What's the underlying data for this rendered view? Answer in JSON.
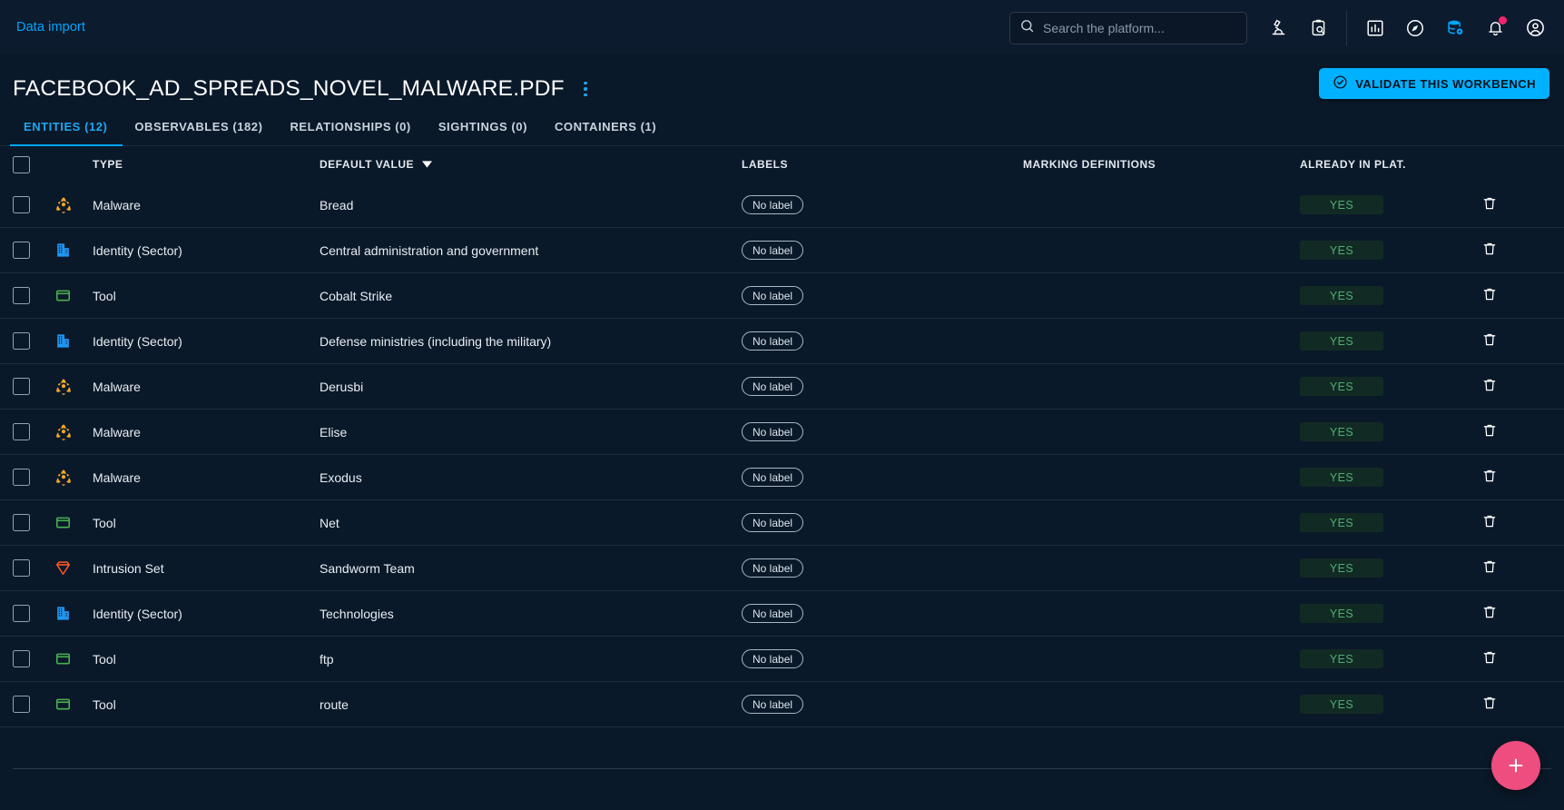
{
  "topbar": {
    "brand_link": "Data import",
    "search": {
      "placeholder": "Search the platform...",
      "value": ""
    },
    "icons": [
      "microscope-icon",
      "clipboard-search-icon",
      "chart-square-icon",
      "compass-icon",
      "database-settings-icon",
      "notification-bell-icon",
      "account-circle-icon"
    ]
  },
  "header": {
    "title": "FACEBOOK_AD_SPREADS_NOVEL_MALWARE.PDF",
    "more_menu": "more-options",
    "validate_label": "VALIDATE THIS WORKBENCH"
  },
  "tabs": [
    {
      "label": "ENTITIES (12)",
      "active": true
    },
    {
      "label": "OBSERVABLES (182)",
      "active": false
    },
    {
      "label": "RELATIONSHIPS (0)",
      "active": false
    },
    {
      "label": "SIGHTINGS (0)",
      "active": false
    },
    {
      "label": "CONTAINERS (1)",
      "active": false
    }
  ],
  "table": {
    "columns": {
      "type": "TYPE",
      "default_value": "DEFAULT VALUE",
      "labels": "LABELS",
      "marking_definitions": "MARKING DEFINITIONS",
      "already_in_plat": "ALREADY IN PLAT."
    },
    "sort": {
      "column": "DEFAULT VALUE",
      "direction": "desc"
    },
    "rows": [
      {
        "type": "Malware",
        "icon": "biohazard-icon",
        "icon_color": "#f9a825",
        "value": "Bread",
        "label": "No label",
        "marking": "",
        "platform": "YES"
      },
      {
        "type": "Identity (Sector)",
        "icon": "building-icon",
        "icon_color": "#2196f3",
        "value": "Central administration and government",
        "label": "No label",
        "marking": "",
        "platform": "YES"
      },
      {
        "type": "Tool",
        "icon": "tool-icon",
        "icon_color": "#4caf50",
        "value": "Cobalt Strike",
        "label": "No label",
        "marking": "",
        "platform": "YES"
      },
      {
        "type": "Identity (Sector)",
        "icon": "building-icon",
        "icon_color": "#2196f3",
        "value": "Defense ministries (including the military)",
        "label": "No label",
        "marking": "",
        "platform": "YES"
      },
      {
        "type": "Malware",
        "icon": "biohazard-icon",
        "icon_color": "#f9a825",
        "value": "Derusbi",
        "label": "No label",
        "marking": "",
        "platform": "YES"
      },
      {
        "type": "Malware",
        "icon": "biohazard-icon",
        "icon_color": "#f9a825",
        "value": "Elise",
        "label": "No label",
        "marking": "",
        "platform": "YES"
      },
      {
        "type": "Malware",
        "icon": "biohazard-icon",
        "icon_color": "#f9a825",
        "value": "Exodus",
        "label": "No label",
        "marking": "",
        "platform": "YES"
      },
      {
        "type": "Tool",
        "icon": "tool-icon",
        "icon_color": "#4caf50",
        "value": "Net",
        "label": "No label",
        "marking": "",
        "platform": "YES"
      },
      {
        "type": "Intrusion Set",
        "icon": "diamond-icon",
        "icon_color": "#ff5722",
        "value": "Sandworm Team",
        "label": "No label",
        "marking": "",
        "platform": "YES"
      },
      {
        "type": "Identity (Sector)",
        "icon": "building-icon",
        "icon_color": "#2196f3",
        "value": "Technologies",
        "label": "No label",
        "marking": "",
        "platform": "YES"
      },
      {
        "type": "Tool",
        "icon": "tool-icon",
        "icon_color": "#4caf50",
        "value": "ftp",
        "label": "No label",
        "marking": "",
        "platform": "YES"
      },
      {
        "type": "Tool",
        "icon": "tool-icon",
        "icon_color": "#4caf50",
        "value": "route",
        "label": "No label",
        "marking": "",
        "platform": "YES"
      }
    ]
  },
  "fab": {
    "label": "+",
    "color": "#ee4d7f"
  },
  "colors": {
    "background": "#0a1929",
    "topbar": "#0c1b2d",
    "accent": "#00a6ff",
    "primary_button": "#00b1ff",
    "fab": "#ee4d7f",
    "yes_text": "#4caf72",
    "notification": "#f4246d"
  }
}
